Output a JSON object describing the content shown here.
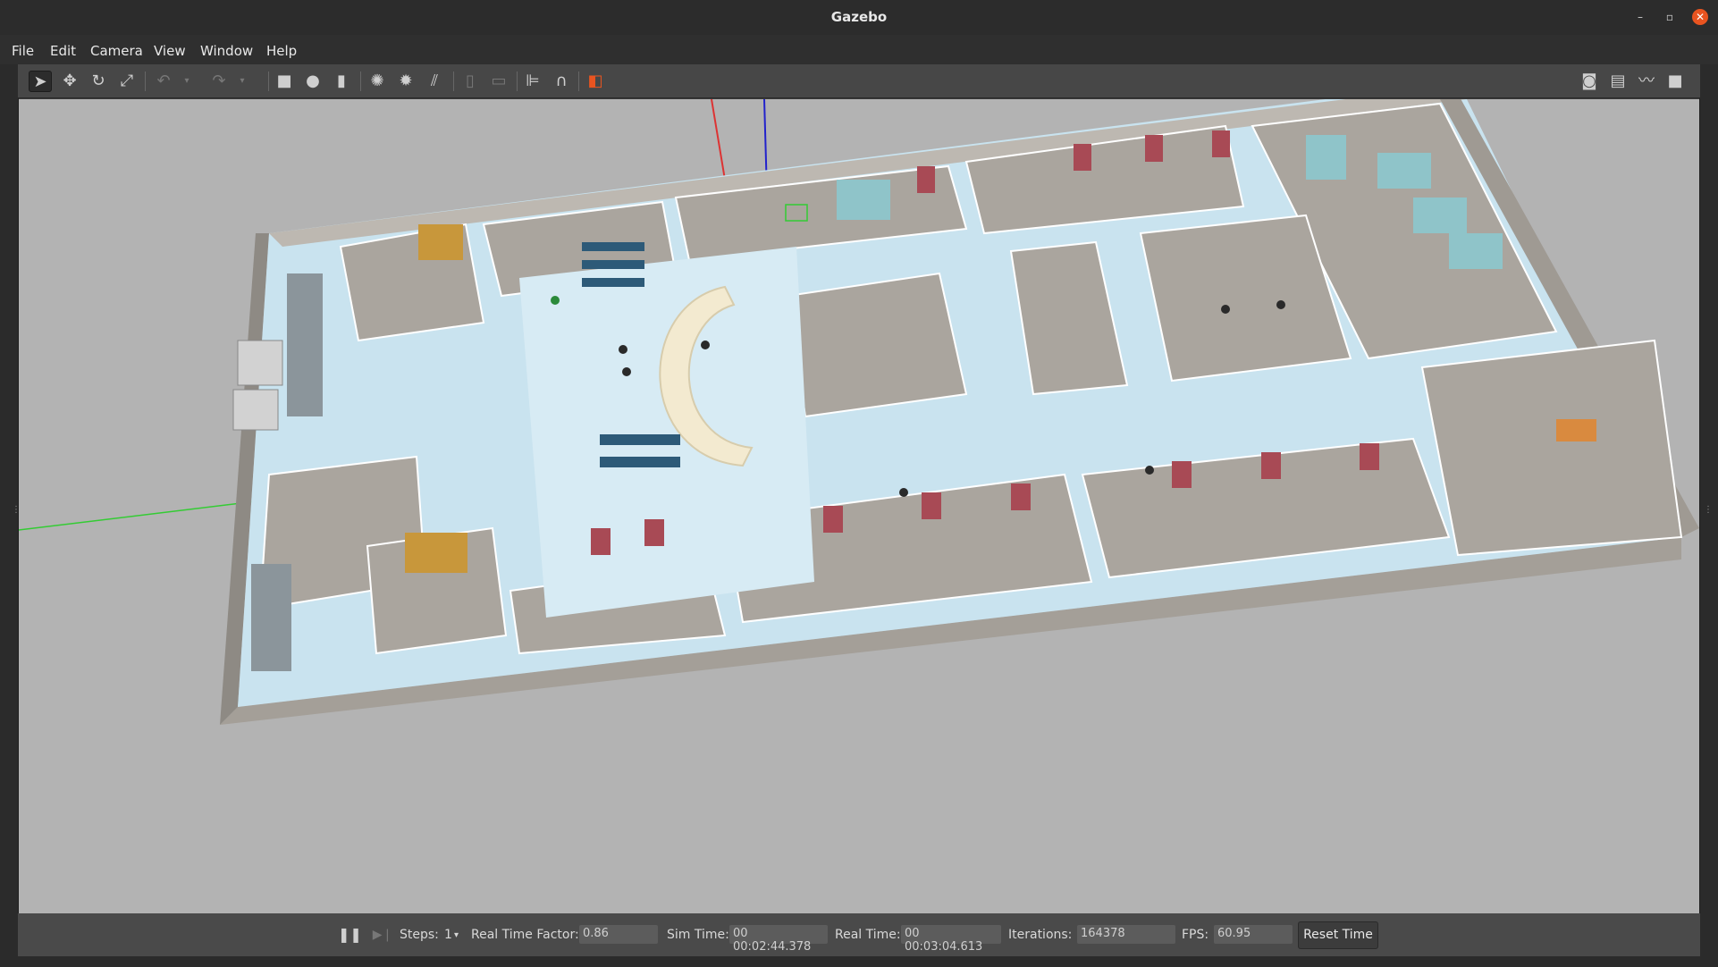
{
  "window": {
    "title": "Gazebo"
  },
  "menu": {
    "file": "File",
    "edit": "Edit",
    "camera": "Camera",
    "view": "View",
    "window": "Window",
    "help": "Help"
  },
  "toolbar": {
    "left_icons": [
      "select-icon",
      "translate-icon",
      "rotate-icon",
      "scale-icon",
      "undo-icon",
      "undo-dropdown-icon",
      "redo-icon",
      "redo-dropdown-icon",
      "box-icon",
      "sphere-icon",
      "cylinder-icon",
      "point-light-icon",
      "spot-light-icon",
      "directional-light-icon",
      "copy-icon",
      "paste-icon",
      "align-icon",
      "snap-icon",
      "view-angle-icon"
    ],
    "right_icons": [
      "screenshot-icon",
      "log-icon",
      "plot-icon",
      "record-video-icon"
    ]
  },
  "status": {
    "steps_label": "Steps:",
    "steps_value": "1",
    "rtf_label": "Real Time Factor:",
    "rtf_value": "0.86",
    "sim_time_label": "Sim Time:",
    "sim_time_value": "00 00:02:44.378",
    "real_time_label": "Real Time:",
    "real_time_value": "00 00:03:04.613",
    "iterations_label": "Iterations:",
    "iterations_value": "164378",
    "fps_label": "FPS:",
    "fps_value": "60.95",
    "reset_label": "Reset Time"
  },
  "colors": {
    "floor": "#c9e3ef",
    "wall": "#a9a49d",
    "ground": "#b3b3b3",
    "accent": "#e95420"
  }
}
